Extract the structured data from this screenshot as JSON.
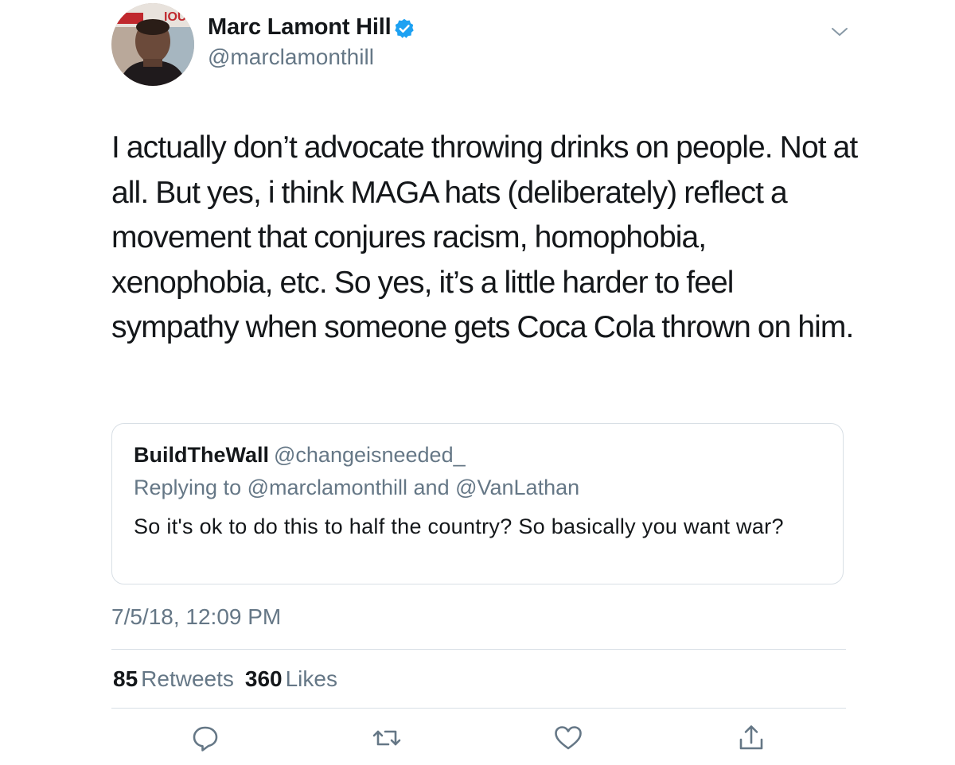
{
  "author": {
    "name": "Marc Lamont Hill",
    "handle": "@marclamonthill",
    "verified": true,
    "avatar_banner_text": "IOU"
  },
  "tweet": {
    "text": "I actually don’t advocate throwing drinks on people. Not at all. But yes, i think MAGA hats (deliberately) reflect a movement that conjures racism, homophobia, xenophobia, etc. So yes, it’s a little harder to feel sympathy when someone gets Coca Cola thrown on him.",
    "timestamp": "7/5/18, 12:09 PM"
  },
  "quoted_tweet": {
    "name": "BuildTheWall",
    "handle": "@changeisneeded_",
    "reply_line": "Replying to @marclamonthill and @VanLathan",
    "text": "So it's ok to do this to half the country? So basically you want war?"
  },
  "stats": {
    "retweets_count": "85",
    "retweets_label": "Retweets",
    "likes_count": "360",
    "likes_label": "Likes"
  },
  "actions": [
    "reply-icon",
    "retweet-icon",
    "like-icon",
    "share-icon"
  ],
  "colors": {
    "text_primary": "#14171a",
    "text_secondary": "#657786",
    "verified_blue": "#1da1f2",
    "divider": "#d8dfe5"
  }
}
